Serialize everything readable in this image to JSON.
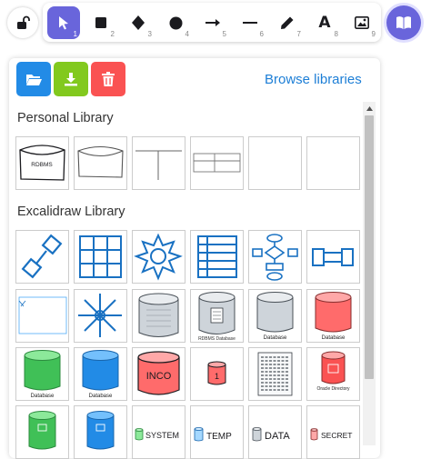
{
  "toolbar": {
    "tools": [
      {
        "name": "selection-tool",
        "icon": "pointer-icon",
        "num": "1",
        "active": true
      },
      {
        "name": "rectangle-tool",
        "icon": "square-icon",
        "num": "2"
      },
      {
        "name": "diamond-tool",
        "icon": "diamond-icon",
        "num": "3"
      },
      {
        "name": "ellipse-tool",
        "icon": "circle-icon",
        "num": "4"
      },
      {
        "name": "arrow-tool",
        "icon": "arrow-icon",
        "num": "5"
      },
      {
        "name": "line-tool",
        "icon": "line-icon",
        "num": "6"
      },
      {
        "name": "draw-tool",
        "icon": "pencil-icon",
        "num": "7"
      },
      {
        "name": "text-tool",
        "icon": "text-icon",
        "num": "8",
        "glyph": "A"
      },
      {
        "name": "image-tool",
        "icon": "image-icon",
        "num": "9"
      }
    ]
  },
  "colors": {
    "accent": "#6965db",
    "open": "#228be6",
    "export": "#82c91e",
    "delete": "#fa5252",
    "link": "#1c7ed6"
  },
  "library": {
    "browse_label": "Browse libraries",
    "personal_title": "Personal Library",
    "excalidraw_title": "Excalidraw Library",
    "personal_items": [
      "RDBMS"
    ],
    "labels": {
      "rdbms_db": "RDBMS Database",
      "database": "Database",
      "inco": "INCO",
      "one": "1",
      "oracle": "Oracle Directory",
      "system": "SYSTEM",
      "temp": "TEMP",
      "data": "DATA",
      "secret": "SECRET"
    }
  }
}
